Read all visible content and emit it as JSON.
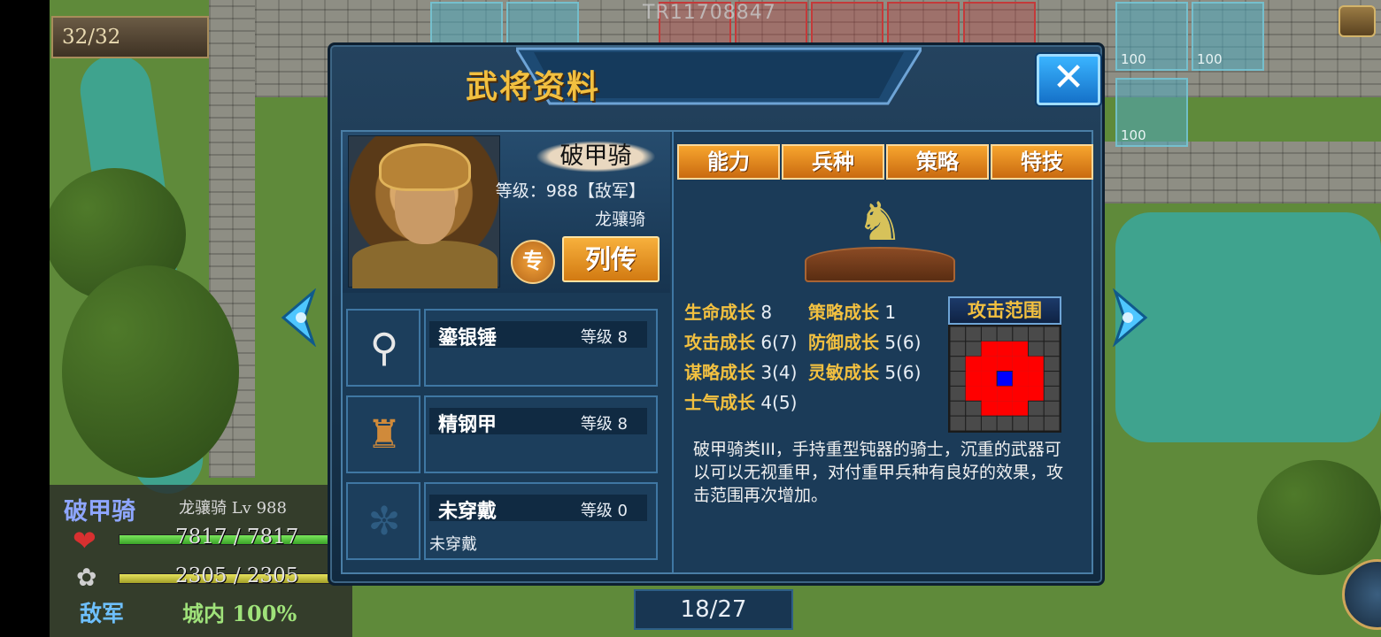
{
  "background": {
    "code": "TR11708847",
    "turn": "32/32",
    "tile_values": [
      "100",
      "100",
      "100"
    ],
    "unit_panel": {
      "name": "破甲骑",
      "class_level": "龙骧骑 Lv 988",
      "hp": "7817 / 7817",
      "mp": "2305 / 2305",
      "side": "敌军",
      "location": "城内 100%"
    },
    "page_counter": "18/27"
  },
  "dialog": {
    "title": "武将资料",
    "close_icon": "close-x-icon",
    "general": {
      "name": "破甲骑",
      "level": "等级：988【敌军】",
      "class": "龙骧骑",
      "spec_badge": "专",
      "bio_button": "列传"
    },
    "equipment": [
      {
        "name": "鎏银锤",
        "level": "等级 8",
        "sub": "",
        "icon": "hammer-icon"
      },
      {
        "name": "精钢甲",
        "level": "等级 8",
        "sub": "",
        "icon": "armor-icon"
      },
      {
        "name": "未穿戴",
        "level": "等级 0",
        "sub": "未穿戴",
        "icon": "empty-slot-icon"
      }
    ],
    "tabs": [
      "能力",
      "兵种",
      "策略",
      "特技"
    ],
    "stats": [
      {
        "label": "生命成长",
        "value": "8"
      },
      {
        "label": "策略成长",
        "value": "1"
      },
      {
        "label": "攻击成长",
        "value": "6(7)"
      },
      {
        "label": "防御成长",
        "value": "5(6)"
      },
      {
        "label": "谋略成长",
        "value": "3(4)"
      },
      {
        "label": "灵敏成长",
        "value": "5(6)"
      },
      {
        "label": "士气成长",
        "value": "4(5)"
      }
    ],
    "attack_range_title": "攻击范围",
    "attack_range": {
      "rows": 7,
      "cols": 7,
      "cells": [
        "0000000",
        "0011100",
        "0111110",
        "0112110",
        "0111110",
        "0011100",
        "0000000"
      ]
    },
    "description": "破甲骑类III，手持重型钝器的骑士，沉重的武器可以可以无视重甲，对付重甲兵种有良好的效果，攻击范围再次增加。"
  },
  "colors": {
    "accent_gold": "#f2c040",
    "tab_orange": "#e58a1e",
    "panel_blue": "#1b3b58",
    "range_red": "#ff0000",
    "range_self": "#0000ff"
  }
}
